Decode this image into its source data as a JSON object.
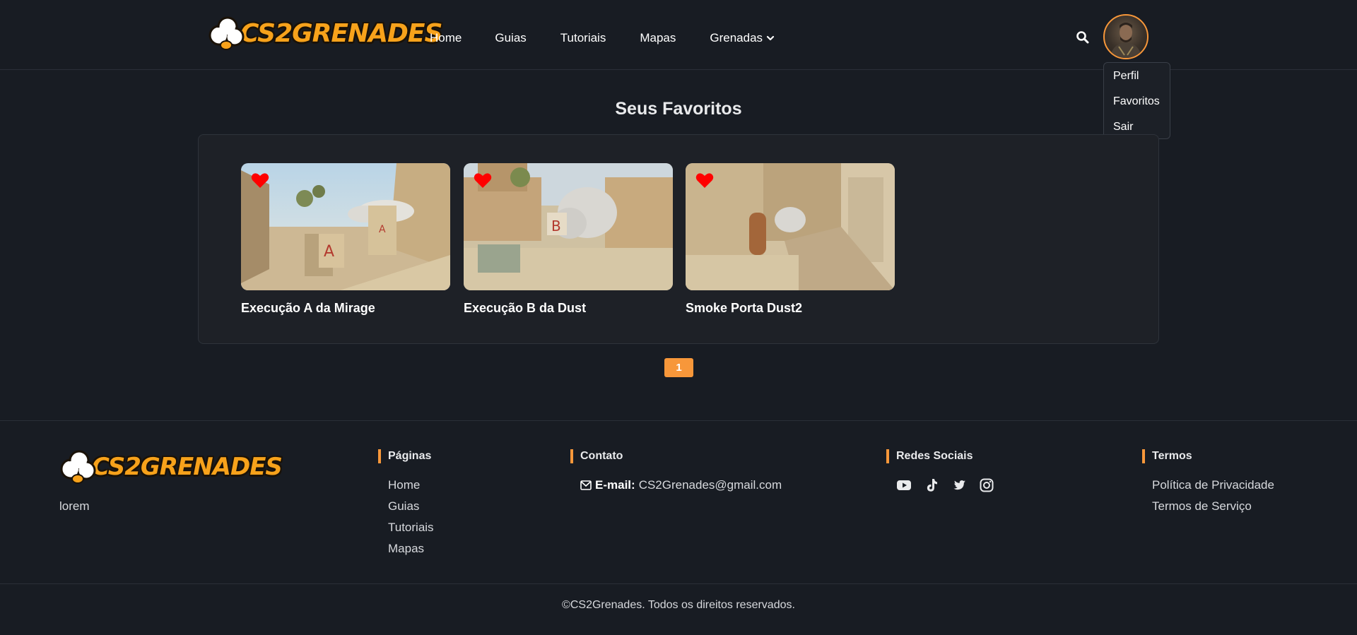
{
  "brand": {
    "name": "CS2GRENADES"
  },
  "nav": {
    "items": [
      {
        "label": "Home"
      },
      {
        "label": "Guias"
      },
      {
        "label": "Tutoriais"
      },
      {
        "label": "Mapas"
      },
      {
        "label": "Grenadas"
      }
    ]
  },
  "user_menu": {
    "items": [
      {
        "label": "Perfil"
      },
      {
        "label": "Favoritos"
      },
      {
        "label": "Sair"
      }
    ]
  },
  "main": {
    "title": "Seus Favoritos",
    "cards": [
      {
        "title": "Execução A da Mirage",
        "favorited": true
      },
      {
        "title": "Execução B da Dust",
        "favorited": true
      },
      {
        "title": "Smoke Porta Dust2",
        "favorited": true
      }
    ],
    "pagination": {
      "current": "1"
    }
  },
  "footer": {
    "tagline": "lorem",
    "pages": {
      "heading": "Páginas",
      "links": [
        "Home",
        "Guias",
        "Tutoriais",
        "Mapas"
      ]
    },
    "contact": {
      "heading": "Contato",
      "email_label": "E-mail:",
      "email": "CS2Grenades@gmail.com"
    },
    "social": {
      "heading": "Redes Sociais",
      "icons": [
        "youtube-icon",
        "tiktok-icon",
        "twitter-icon",
        "instagram-icon"
      ]
    },
    "terms": {
      "heading": "Termos",
      "links": [
        "Política de Privacidade",
        "Termos de Serviço"
      ]
    },
    "copyright": "©CS2Grenades. Todos os direitos reservados."
  },
  "colors": {
    "background": "#181c23",
    "panel": "#1e2127",
    "accent": "#f7973a",
    "heart": "#ff0000",
    "logo": "#f7a21b"
  }
}
